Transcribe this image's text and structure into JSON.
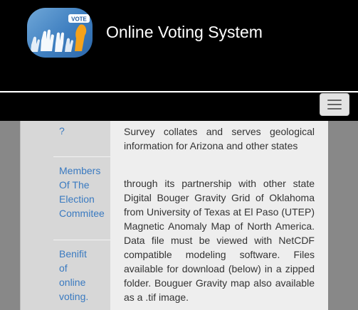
{
  "header": {
    "title": "Online Voting System",
    "logo_badge": "VOTE"
  },
  "navbar": {
    "toggle_icon": "hamburger-menu-icon"
  },
  "sidebar": {
    "items": [
      {
        "label": "?"
      },
      {
        "label": "Members Of The Election Commitee"
      },
      {
        "label": "Benifit of online voting."
      }
    ]
  },
  "main": {
    "paragraph1": "Survey collates and serves geological information for Arizona and other states",
    "paragraph2": "through its partnership with other state Digital Bouger Gravity Grid of Oklahoma from University of Texas at El Paso (UTEP) Magnetic Anomaly Map of North America. Data file must be viewed with NetCDF compatible modeling software. Files available for download (below) in a zipped folder. Bouguer Gravity map also available as a .tif image."
  },
  "colors": {
    "header_bg": "#000000",
    "link": "#3a7ac0",
    "text": "#333333",
    "logo_orange": "#f5a21b",
    "logo_blue": "#3f7fc0"
  }
}
